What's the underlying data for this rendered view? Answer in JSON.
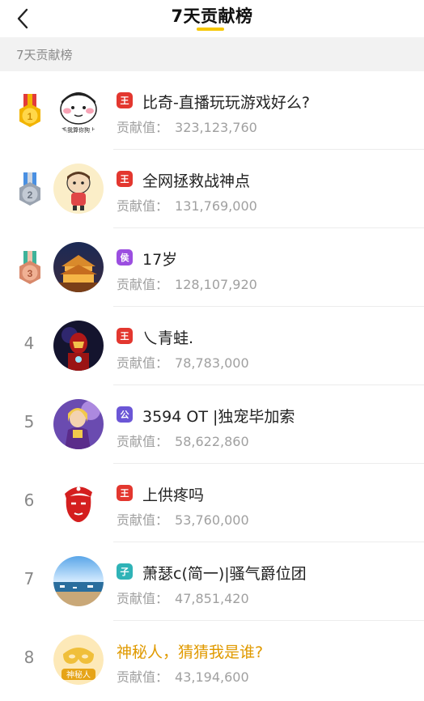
{
  "header": {
    "title": "7天贡献榜"
  },
  "section": {
    "label": "7天贡献榜"
  },
  "contribution_label": "贡献值：",
  "rows": [
    {
      "rank": "1",
      "name": "比奇-直播玩玩游戏好么?",
      "badge": "王",
      "value": "323,123,760",
      "avatar_caption": "毛我算你狗上"
    },
    {
      "rank": "2",
      "name": "全网拯救战神点",
      "badge": "王",
      "value": "131,769,000"
    },
    {
      "rank": "3",
      "name": "17岁",
      "badge": "侯",
      "value": "128,107,920"
    },
    {
      "rank": "4",
      "name": "乀青蛙.",
      "badge": "王",
      "value": "78,783,000"
    },
    {
      "rank": "5",
      "name": "3594 OT |独宠毕加索",
      "badge": "公",
      "value": "58,622,860"
    },
    {
      "rank": "6",
      "name": "上供疼吗",
      "badge": "王",
      "value": "53,760,000"
    },
    {
      "rank": "7",
      "name": "萧瑟c(简一)|骚气爵位团",
      "badge": "子",
      "value": "47,851,420"
    },
    {
      "rank": "8",
      "name": "神秘人，猜猜我是谁?",
      "value": "43,194,600",
      "avatar_caption": "神秘人"
    }
  ],
  "colors": {
    "accent": "#f6c700",
    "gold": "#f2b400",
    "silver": "#9aa3b0",
    "bronze": "#d8896b",
    "badge_red": "#e3372f",
    "mystery": "#e09a00"
  }
}
